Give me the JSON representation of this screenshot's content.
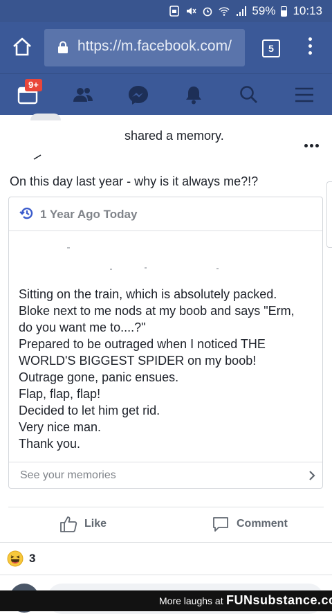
{
  "status_bar": {
    "battery": "59%",
    "time": "10:13",
    "icons": [
      "sim-icon",
      "mute-icon",
      "alarm-icon",
      "wifi-icon",
      "signal-icon",
      "battery-icon"
    ]
  },
  "browser": {
    "url": "https://m.facebook.com/",
    "tab_count": "5"
  },
  "nav": {
    "notification_badge": "9+",
    "items": [
      "feed-icon",
      "friends-icon",
      "messenger-icon",
      "notifications-icon",
      "search-icon",
      "menu-icon"
    ]
  },
  "post": {
    "action_text": "shared a memory.",
    "text": "On this day last year - why is it always me?!?",
    "memory": {
      "header": "1 Year Ago Today",
      "lines": [
        "Sitting on the train, which is absolutely packed.",
        "Bloke next to me nods at my boob and says \"Erm,",
        "do you want me to....?\"",
        "Prepared to be outraged when I noticed THE",
        "WORLD'S BIGGEST SPIDER on my boob!",
        "Outrage gone, panic ensues.",
        "Flap, flap, flap!",
        "Decided to let him get rid.",
        "Very nice man.",
        "Thank you."
      ],
      "footer": "See your memories"
    },
    "actions": {
      "like": "Like",
      "comment": "Comment"
    },
    "reactions": {
      "count": "3"
    }
  },
  "watermark": {
    "text": "More laughs at",
    "brand": "FUNsubstance.com"
  },
  "colors": {
    "facebook_blue": "#3b5998",
    "status_bar": "#39558f",
    "url_field": "#5a74ab"
  }
}
